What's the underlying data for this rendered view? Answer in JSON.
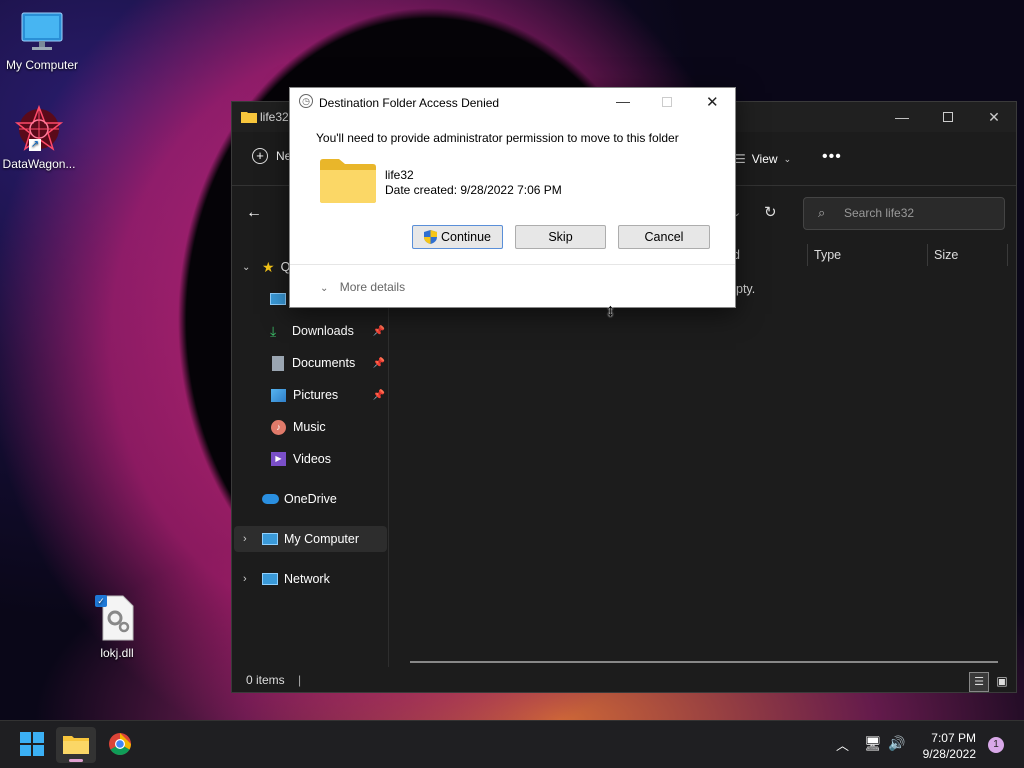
{
  "desktop": {
    "icons": [
      {
        "label": "My Computer"
      },
      {
        "label": "DataWagon..."
      },
      {
        "label": "lokj.dll"
      }
    ]
  },
  "explorer": {
    "title": "life32",
    "toolbar": {
      "new_label": "Ne",
      "view_label": "View"
    },
    "search_placeholder": "Search life32",
    "nav": {
      "quick_access_label": "Q",
      "items": [
        {
          "label": "Downloads"
        },
        {
          "label": "Documents"
        },
        {
          "label": "Pictures"
        },
        {
          "label": "Music"
        },
        {
          "label": "Videos"
        },
        {
          "label": "OneDrive"
        },
        {
          "label": "My Computer"
        },
        {
          "label": "Network"
        }
      ]
    },
    "columns": {
      "date": "ed",
      "type": "Type",
      "size": "Size"
    },
    "empty_text": "pty.",
    "status": "0 items"
  },
  "dialog": {
    "title": "Destination Folder Access Denied",
    "message": "You'll need to provide administrator permission to move to this folder",
    "file_name": "life32",
    "file_date": "Date created: 9/28/2022 7:06 PM",
    "buttons": {
      "continue": "Continue",
      "skip": "Skip",
      "cancel": "Cancel"
    },
    "more_details": "More details"
  },
  "taskbar": {
    "time": "7:07 PM",
    "date": "9/28/2022",
    "notification_count": "1"
  },
  "colors": {
    "accent": "#0078d4",
    "folder_yellow": "#f8c63c"
  }
}
